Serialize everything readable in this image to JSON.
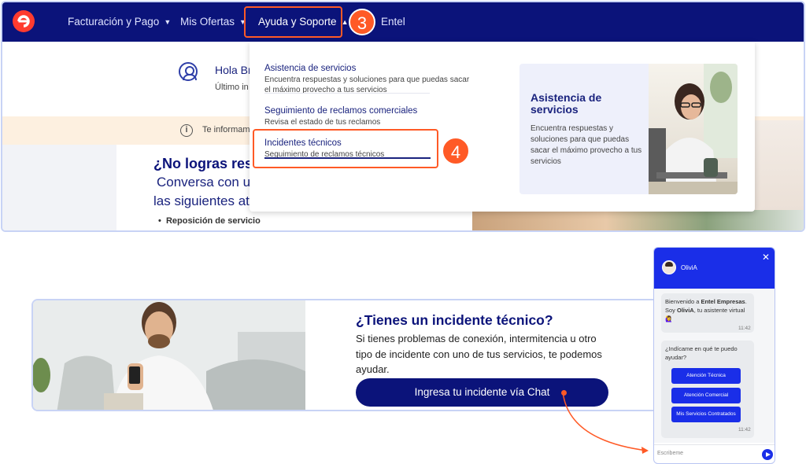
{
  "navbar": {
    "items": [
      {
        "label": "Facturación y Pago"
      },
      {
        "label": "Mis Ofertas"
      },
      {
        "label": "Ayuda y Soporte"
      },
      {
        "label": "Entel"
      }
    ],
    "step_badge": "3",
    "caret_down": "▼",
    "caret_up": "▲"
  },
  "greeting": {
    "hello": "Hola Br",
    "last": "Último in"
  },
  "info_band": {
    "icon": "i",
    "text": "Te informam"
  },
  "page_body": {
    "heading": "¿No logras resol",
    "line1": "Conversa con ur",
    "line2": "las siguientes at",
    "bullet": "Reposición de servicio"
  },
  "dropdown": {
    "items": [
      {
        "title": "Asistencia de servicios",
        "desc": "Encuentra respuestas y soluciones para que puedas sacar el máximo provecho a tus servicios"
      },
      {
        "title": "Seguimiento de reclamos comerciales",
        "desc": "Revisa el estado de tus reclamos"
      },
      {
        "title": "Incidentes técnicos",
        "desc": "Seguimiento de reclamos técnicos"
      }
    ],
    "step_badge": "4",
    "promo": {
      "title": "Asistencia de servicios",
      "text": "Encuentra respuestas y soluciones para que puedas sacar el máximo provecho a tus servicios"
    }
  },
  "banner": {
    "title": "¿Tienes un incidente técnico?",
    "text": "Si tienes problemas de conexión, intermitencia u otro tipo de incidente con uno de tus servicios, te podemos ayudar.",
    "button": "Ingresa tu incidente vía Chat"
  },
  "chat": {
    "name": "OliviA",
    "close": "✕",
    "msg1": {
      "p1": "Bienvenido a ",
      "b1": "Entel Empresas",
      "p2": ". Soy ",
      "b2": "OliviA",
      "p3": ", tu asistente virtual 🙋‍♀️",
      "time": "11:42"
    },
    "msg2": {
      "text": "¿Indícame en qué te puedo ayudar?",
      "options": [
        "Atención Técnica",
        "Atención Comercial",
        "Mis Servicios Contratados"
      ],
      "time": "11:42"
    },
    "input_placeholder": "Escribeme"
  },
  "colors": {
    "navy": "#0b137a",
    "accent_orange": "#ff5a26",
    "chat_blue": "#1a2ee8"
  }
}
